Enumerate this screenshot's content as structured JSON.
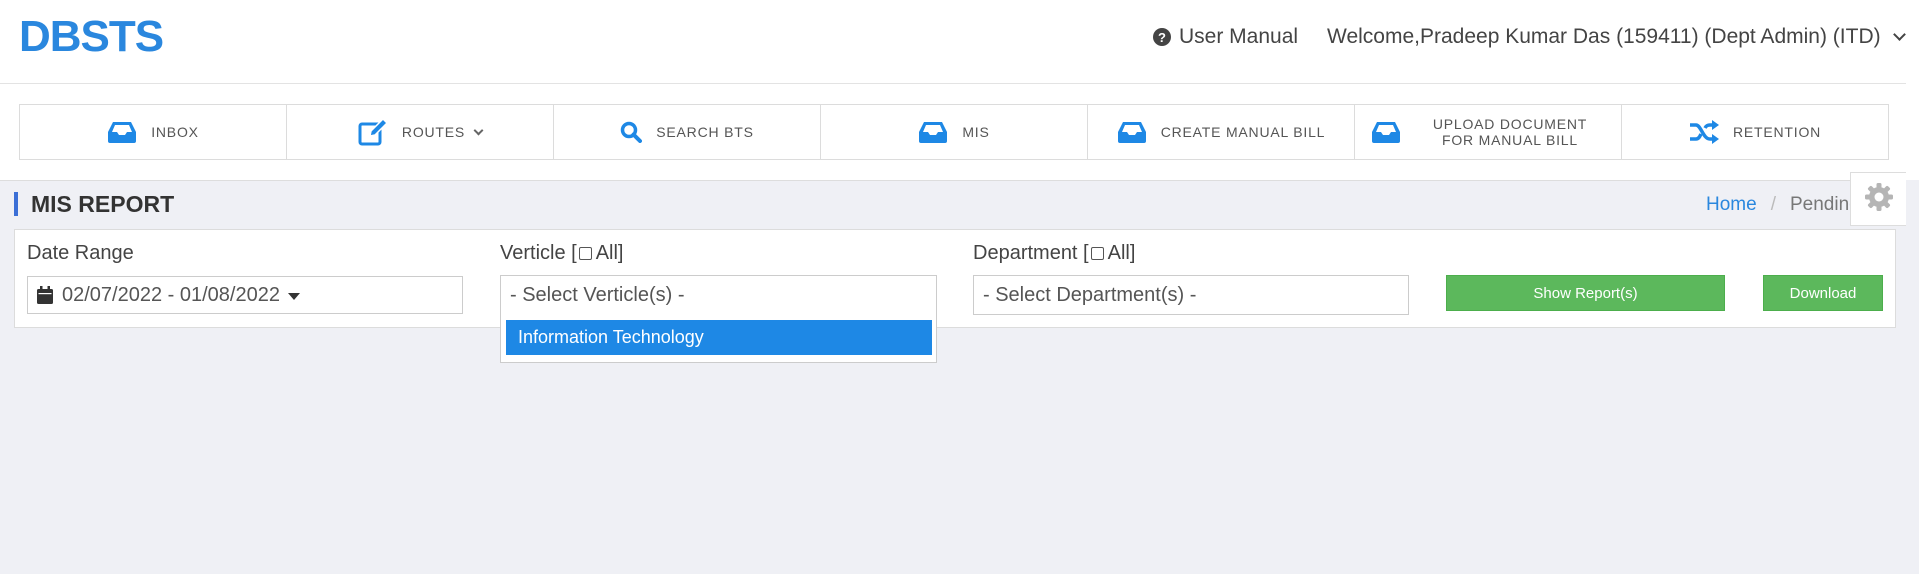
{
  "app": {
    "logo": "DBSTS"
  },
  "header": {
    "user_manual": "User Manual",
    "welcome": "Welcome,Pradeep Kumar Das (159411) (Dept Admin) (ITD)"
  },
  "nav": [
    {
      "label": "INBOX",
      "icon": "inbox-icon"
    },
    {
      "label": "ROUTES",
      "icon": "edit-icon"
    },
    {
      "label": "SEARCH BTS",
      "icon": "search-icon"
    },
    {
      "label": "MIS",
      "icon": "inbox-icon"
    },
    {
      "label": "CREATE MANUAL BILL",
      "icon": "inbox-icon"
    },
    {
      "label": "UPLOAD DOCUMENT FOR MANUAL BILL",
      "icon": "inbox-icon"
    },
    {
      "label": "RETENTION",
      "icon": "shuffle-icon"
    }
  ],
  "page": {
    "title": "MIS REPORT",
    "breadcrumb": {
      "home": "Home",
      "separator": "/",
      "current": "Pending"
    }
  },
  "filters": {
    "date_range": {
      "label": "Date Range",
      "value": "02/07/2022 - 01/08/2022"
    },
    "verticle": {
      "label_prefix": "Verticle [",
      "label_suffix": "All]",
      "placeholder": "- Select Verticle(s) -",
      "options": [
        "Information Technology"
      ]
    },
    "department": {
      "label_prefix": "Department [",
      "label_suffix": "All]",
      "placeholder": "- Select Department(s) -"
    },
    "show_report_label": "Show Report(s)",
    "download_label": "Download"
  },
  "colors": {
    "brand": "#2a87de",
    "accent_bar": "#3b6fd6",
    "button_green": "#5cb85c",
    "selected_option": "#1e88e5",
    "page_bg": "#eff0f5"
  }
}
